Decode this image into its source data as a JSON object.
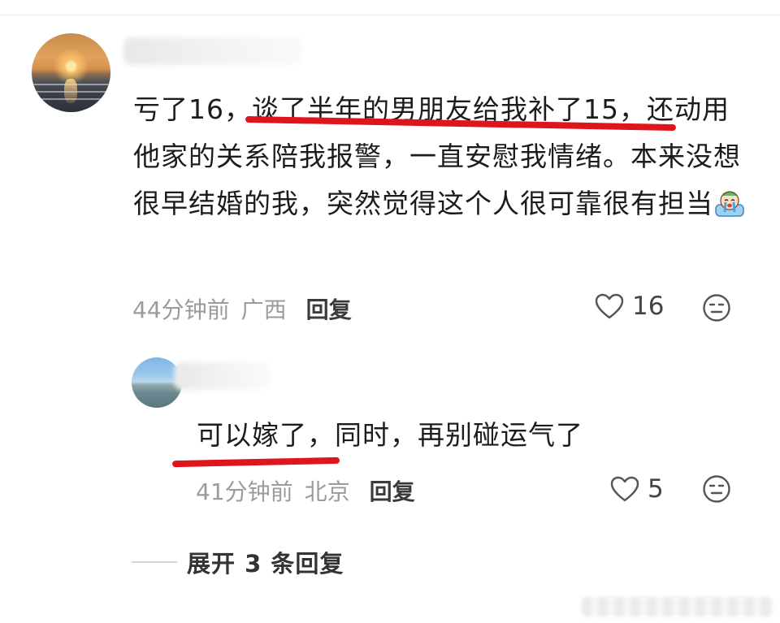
{
  "comment": {
    "text": "亏了16，谈了半年的男朋友给我补了15，还动用他家的关系陪我报警，一直安慰我情绪。本来没想很早结婚的我，突然觉得这个人很可靠很有担当",
    "emoji_icon": "crying-face-emoji-icon",
    "time": "44分钟前",
    "location": "广西",
    "reply_label": "回复",
    "likes": "16"
  },
  "reply": {
    "text": "可以嫁了，同时，再别碰运气了",
    "time": "41分钟前",
    "location": "北京",
    "reply_label": "回复",
    "likes": "5"
  },
  "expand": {
    "label": "展开 3 条回复"
  },
  "colors": {
    "underline": "#e0141c",
    "meta_gray": "#9b9b9b"
  }
}
